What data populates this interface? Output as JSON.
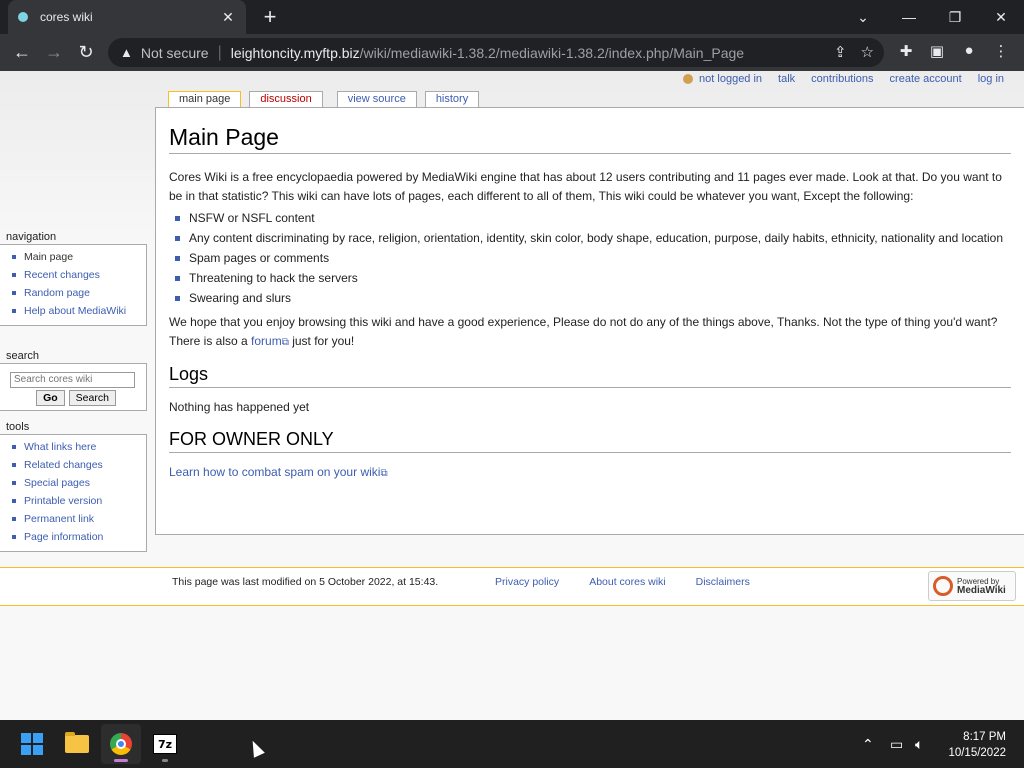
{
  "browser": {
    "tab_title": "cores wiki",
    "tab_close": "✕",
    "new_tab": "+",
    "not_secure": "Not secure",
    "url_host": "leightoncity.myftp.biz",
    "url_path": "/wiki/mediawiki-1.38.2/mediawiki-1.38.2/index.php/Main_Page"
  },
  "personal": {
    "items": [
      "not logged in",
      "talk",
      "contributions",
      "create account",
      "log in"
    ]
  },
  "tabs": {
    "main_page": "main page",
    "discussion": "discussion",
    "view_source": "view source",
    "history": "history"
  },
  "article": {
    "title": "Main Page",
    "intro": "Cores Wiki is a free encyclopaedia powered by MediaWiki engine that has about 12 users contributing and 11 pages ever made. Look at that. Do you want to be in that statistic? This wiki can have lots of pages, each different to all of them, This wiki could be whatever you want, Except the following:",
    "rules": [
      "NSFW or NSFL content",
      "Any content discriminating by race, religion, orientation, identity, skin color, body shape, education, purpose, daily habits, ethnicity, nationality and location",
      "Spam pages or comments",
      "Threatening to hack the servers",
      "Swearing and slurs"
    ],
    "outro_before": "We hope that you enjoy browsing this wiki and have a good experience, Please do not do any of the things above, Thanks. Not the type of thing you'd want? There is also a",
    "forum_link": "forum",
    "outro_after": "just for you!",
    "logs_heading": "Logs",
    "logs_text": "Nothing has happened yet",
    "owner_heading": "FOR OWNER ONLY",
    "spam_link": "Learn how to combat spam on your wiki"
  },
  "sidebar": {
    "navigation_title": "navigation",
    "navigation": [
      "Main page",
      "Recent changes",
      "Random page",
      "Help about MediaWiki"
    ],
    "search_title": "search",
    "search_placeholder": "Search cores wiki",
    "go_label": "Go",
    "search_label": "Search",
    "tools_title": "tools",
    "tools": [
      "What links here",
      "Related changes",
      "Special pages",
      "Printable version",
      "Permanent link",
      "Page information"
    ]
  },
  "footer": {
    "last_modified": "This page was last modified on 5 October 2022, at 15:43.",
    "links": [
      "Privacy policy",
      "About cores wiki",
      "Disclaimers"
    ],
    "powered_line1": "Powered by",
    "powered_line2": "MediaWiki"
  },
  "taskbar": {
    "sevenzip_label": "7z",
    "time": "8:17 PM",
    "date": "10/15/2022"
  },
  "colors": {
    "link": "#3d5db0",
    "new_link": "#ba0000",
    "accent": "#fabd23"
  }
}
